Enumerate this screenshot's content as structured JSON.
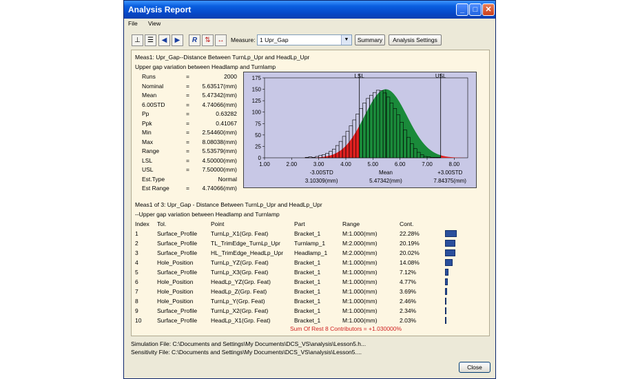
{
  "window": {
    "title": "Analysis Report",
    "minimize": "_",
    "maximize": "□",
    "close": "✕"
  },
  "menu": {
    "file": "File",
    "view": "View"
  },
  "toolbar": {
    "icons": [
      "histogram-icon",
      "table-icon",
      "back-arrow-icon",
      "forward-arrow-icon",
      "r-icon",
      "contributor-icon",
      "range-icon"
    ],
    "measure_label": "Measure:",
    "measure_value": "1 Upr_Gap",
    "summary_button": "Summary",
    "settings_button": "Analysis Settings"
  },
  "report": {
    "heading": "Meas1: Upr_Gap--Distance Between TurnLp_Upr and HeadLp_Upr",
    "subheading": "Upper gap variation between Headlamp and Turnlamp",
    "stats": [
      {
        "name": "Runs",
        "eq": "=",
        "value": "2000"
      },
      {
        "name": "Nominal",
        "eq": "=",
        "value": "5.63517(mm)"
      },
      {
        "name": "Mean",
        "eq": "=",
        "value": "5.47342(mm)"
      },
      {
        "name": "6.00STD",
        "eq": "=",
        "value": "4.74066(mm)"
      },
      {
        "name": "Pp",
        "eq": "=",
        "value": "0.63282"
      },
      {
        "name": "Ppk",
        "eq": "=",
        "value": "0.41067"
      },
      {
        "name": "Min",
        "eq": "=",
        "value": "2.54460(mm)"
      },
      {
        "name": "Max",
        "eq": "=",
        "value": "8.08038(mm)"
      },
      {
        "name": "Range",
        "eq": "=",
        "value": "5.53579(mm)"
      },
      {
        "name": "LSL",
        "eq": "=",
        "value": "4.50000(mm)"
      },
      {
        "name": "USL",
        "eq": "=",
        "value": "7.50000(mm)"
      },
      {
        "name": "Est.Type",
        "eq": "",
        "value": "Normal"
      },
      {
        "name": "Est Range",
        "eq": "=",
        "value": "4.74066(mm)"
      }
    ],
    "contrib_heading": "Meas1 of 3: Upr_Gap - Distance Between TurnLp_Upr and HeadLp_Upr",
    "contrib_subheading": "--Upper gap variation between Headlamp and Turnlamp",
    "columns": [
      "Index",
      "Tol.",
      "Point",
      "Part",
      "Range",
      "Cont."
    ],
    "rows": [
      {
        "index": "1",
        "tol": "Surface_Profile",
        "point": "TurnLp_X1(Grp. Feat)",
        "part": "Bracket_1",
        "range": "M:1.000(mm)",
        "cont": "22.28%",
        "pct": 22.28
      },
      {
        "index": "2",
        "tol": "Surface_Profile",
        "point": "TL_TrimEdge_TurnLp_Upr",
        "part": "Turnlamp_1",
        "range": "M:2.000(mm)",
        "cont": "20.19%",
        "pct": 20.19
      },
      {
        "index": "3",
        "tol": "Surface_Profile",
        "point": "HL_TrimEdge_HeadLp_Upr",
        "part": "Headlamp_1",
        "range": "M:2.000(mm)",
        "cont": "20.02%",
        "pct": 20.02
      },
      {
        "index": "4",
        "tol": "Hole_Position",
        "point": "TurnLp_YZ(Grp. Feat)",
        "part": "Bracket_1",
        "range": "M:1.000(mm)",
        "cont": "14.08%",
        "pct": 14.08
      },
      {
        "index": "5",
        "tol": "Surface_Profile",
        "point": "TurnLp_X3(Grp. Feat)",
        "part": "Bracket_1",
        "range": "M:1.000(mm)",
        "cont": "7.12%",
        "pct": 7.12
      },
      {
        "index": "6",
        "tol": "Hole_Position",
        "point": "HeadLp_YZ(Grp. Feat)",
        "part": "Bracket_1",
        "range": "M:1.000(mm)",
        "cont": "4.77%",
        "pct": 4.77
      },
      {
        "index": "7",
        "tol": "Hole_Position",
        "point": "HeadLp_Z(Grp. Feat)",
        "part": "Bracket_1",
        "range": "M:1.000(mm)",
        "cont": "3.69%",
        "pct": 3.69
      },
      {
        "index": "8",
        "tol": "Hole_Position",
        "point": "TurnLp_Y(Grp. Feat)",
        "part": "Bracket_1",
        "range": "M:1.000(mm)",
        "cont": "2.46%",
        "pct": 2.46
      },
      {
        "index": "9",
        "tol": "Surface_Profile",
        "point": "TurnLp_X2(Grp. Feat)",
        "part": "Bracket_1",
        "range": "M:1.000(mm)",
        "cont": "2.34%",
        "pct": 2.34
      },
      {
        "index": "10",
        "tol": "Surface_Profile",
        "point": "HeadLp_X1(Grp. Feat)",
        "part": "Bracket_1",
        "range": "M:1.000(mm)",
        "cont": "2.03%",
        "pct": 2.03
      }
    ],
    "sum_rest": "Sum Of Rest 8 Contributors = +1.030000%"
  },
  "chart_data": {
    "type": "bar",
    "title": "",
    "xlabel": "",
    "ylabel": "",
    "xlim": [
      1.0,
      8.5
    ],
    "ylim": [
      0,
      175
    ],
    "xticks": [
      "1.00",
      "2.00",
      "3.00",
      "4.00",
      "5.00",
      "6.00",
      "7.00",
      "8.00"
    ],
    "yticks": [
      "0",
      "25",
      "50",
      "75",
      "100",
      "125",
      "150",
      "175"
    ],
    "bin_width": 0.125,
    "bin_start": 2.5,
    "bins": [
      1,
      2,
      1,
      3,
      5,
      7,
      10,
      14,
      19,
      27,
      36,
      47,
      58,
      70,
      83,
      96,
      108,
      120,
      130,
      137,
      143,
      148,
      147,
      142,
      133,
      120,
      108,
      94,
      78,
      61,
      45,
      31,
      20,
      12,
      7,
      3,
      2,
      1,
      1,
      1
    ],
    "fit_curve": {
      "mean": 5.47342,
      "std": 0.79011,
      "peak": 150
    },
    "lsl": 4.5,
    "usl": 7.5,
    "lsl_label": "LSL",
    "usl_label": "USL",
    "markers": [
      {
        "label": "-3.00STD",
        "value_text": "3.10309(mm)",
        "x": 3.10309
      },
      {
        "label": "Mean",
        "value_text": "5.47342(mm)",
        "x": 5.47342
      },
      {
        "label": "+3.00STD",
        "value_text": "7.84375(mm)",
        "x": 7.84375
      }
    ],
    "colors": {
      "background": "#c8c8e6",
      "inside": "#1a8a3a",
      "outside": "#e02020",
      "bars": "#000000"
    }
  },
  "footer": {
    "simulation": "Simulation File: C:\\Documents and Settings\\My Documents\\DCS_VS\\analysis\\Lesson5.h...",
    "sensitivity": "Sensitivity File: C:\\Documents and Settings\\My Documents\\DCS_VS\\analysis\\Lesson5....",
    "close_button": "Close"
  }
}
